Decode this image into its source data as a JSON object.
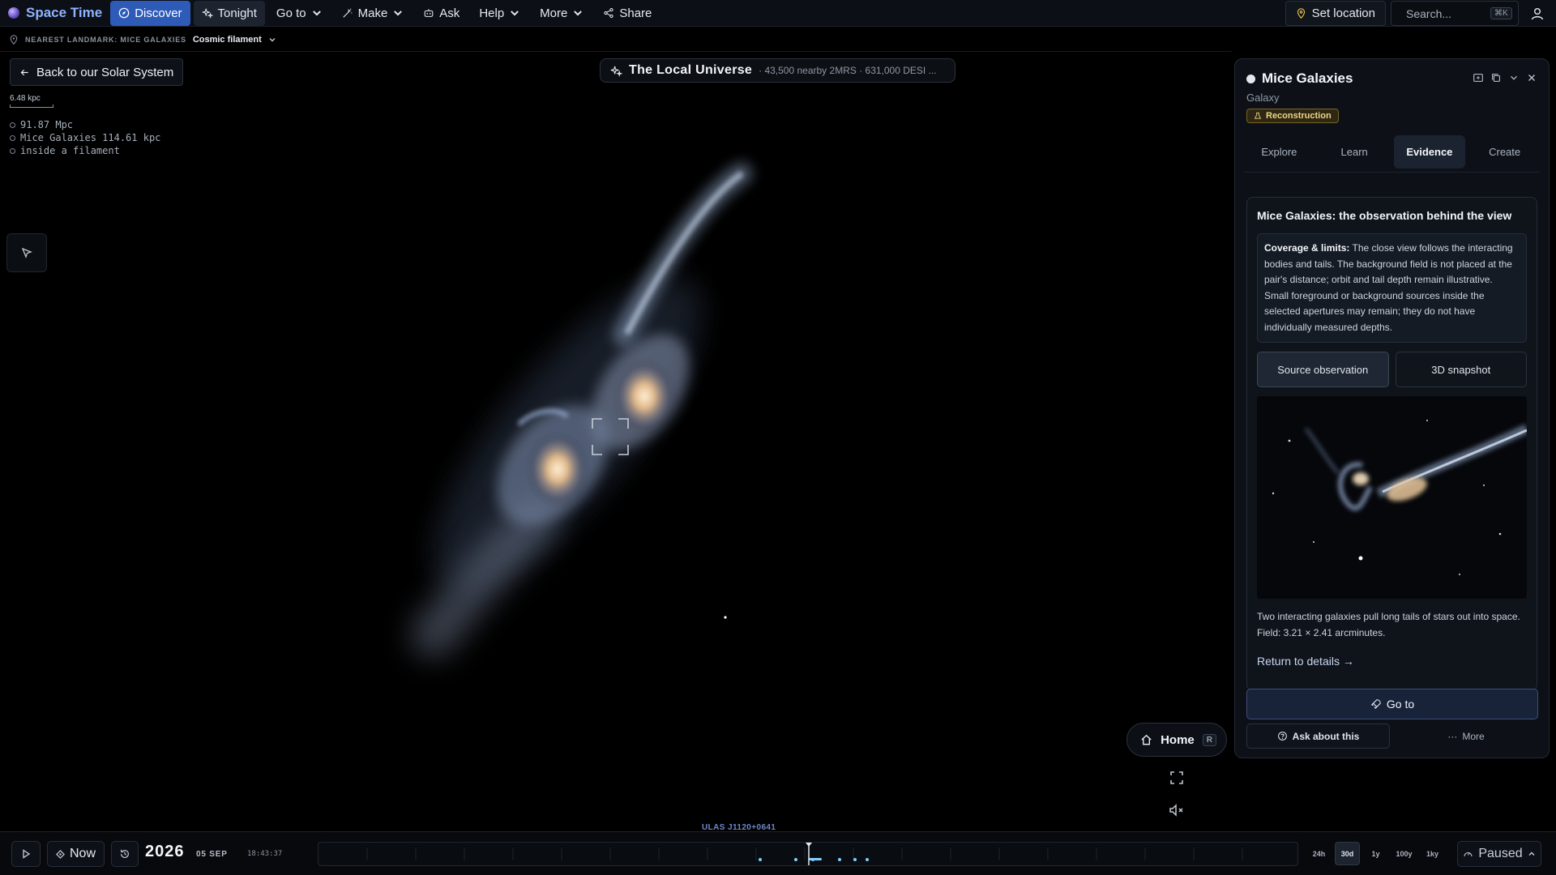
{
  "app": {
    "name": "Space Time"
  },
  "nav": {
    "items": [
      {
        "label": "Discover",
        "icon": "compass-icon",
        "state": "active-blue"
      },
      {
        "label": "Tonight",
        "icon": "sparkle-icon",
        "state": "active-dark"
      },
      {
        "label": "Go to",
        "icon": "",
        "dropdown": true
      },
      {
        "label": "Make",
        "icon": "wand-icon",
        "dropdown": true
      },
      {
        "label": "Ask",
        "icon": "robot-icon"
      },
      {
        "label": "Help",
        "icon": "",
        "dropdown": true
      },
      {
        "label": "More",
        "icon": "",
        "dropdown": true
      },
      {
        "label": "Share",
        "icon": "share-icon"
      }
    ],
    "set_location": "Set location",
    "search_placeholder": "Search...",
    "search_shortcut": "⌘K"
  },
  "landmark": {
    "label": "NEAREST LANDMARK: MICE GALAXIES",
    "value": "Cosmic filament"
  },
  "view": {
    "back_label": "Back to our Solar System",
    "scale_label": "6.48 kpc",
    "stats": [
      "91.87 Mpc",
      "Mice Galaxies 114.61 kpc",
      "inside a filament"
    ],
    "title": "The Local Universe",
    "subtitle": "· 43,500 nearby 2MRS · 631,000 DESI ..."
  },
  "controls": {
    "home_label": "Home",
    "home_shortcut": "R"
  },
  "panel": {
    "title": "Mice Galaxies",
    "type": "Galaxy",
    "badge": "Reconstruction",
    "tabs": [
      "Explore",
      "Learn",
      "Evidence",
      "Create"
    ],
    "active_tab": "Evidence",
    "card_title": "Mice Galaxies: the observation behind the view",
    "coverage_label": "Coverage & limits:",
    "coverage_text": " The close view follows the interacting bodies and tails. The background field is not placed at the pair's distance; orbit and tail depth remain illustrative. Small foreground or background sources inside the selected apertures may remain; they do not have individually measured depths.",
    "segments": [
      "Source observation",
      "3D snapshot"
    ],
    "caption": "Two interacting galaxies pull long tails of stars out into space. Field: 3.21 × 2.41 arcminutes.",
    "return_link": "Return to details →",
    "goto_label": "Go to",
    "ask_label": "Ask about this",
    "more_label": "More"
  },
  "timeline": {
    "marker_label": "ULAS J1120+0641",
    "now_label": "Now",
    "year": "2026",
    "date": "05 SEP",
    "time": "18:43:37",
    "zoom_levels": [
      "24h",
      "30d",
      "1y",
      "100y",
      "1ky"
    ],
    "active_zoom": "30d",
    "status": "Paused"
  },
  "colors": {
    "accent": "#2f5bb8",
    "brand": "#8fb3ff",
    "badge": "#f0d688"
  }
}
